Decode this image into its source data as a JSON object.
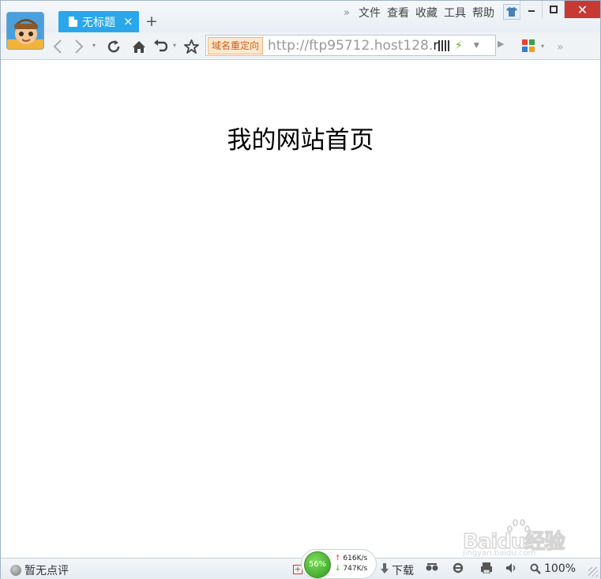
{
  "tabs": [
    {
      "title": "无标题",
      "close": "×"
    }
  ],
  "new_tab": "+",
  "menu": {
    "more": "»",
    "items": [
      "文件",
      "查看",
      "收藏",
      "工具",
      "帮助"
    ]
  },
  "window_controls": {
    "close": "✕"
  },
  "toolbar": {
    "redirect_label": "域名重定向",
    "url_prefix": "http://ftp95712.host128.",
    "url_tail": "n",
    "more": "»"
  },
  "page": {
    "heading": "我的网站首页"
  },
  "statusbar": {
    "rating": "暂无点评",
    "speed_percent": "56%",
    "upload_rate": "616K/s",
    "download_rate": "747K/s",
    "download_label": "下载",
    "zoom": "100%"
  },
  "watermark": {
    "brand": "Baidu经验",
    "sub": "jingyan.baidu.com"
  },
  "colors": {
    "tab_active": "#2aa7ea",
    "close_button": "#c73a34",
    "redirect_bg": "#fde8cf",
    "speed_ball": "#2e9a1e"
  }
}
